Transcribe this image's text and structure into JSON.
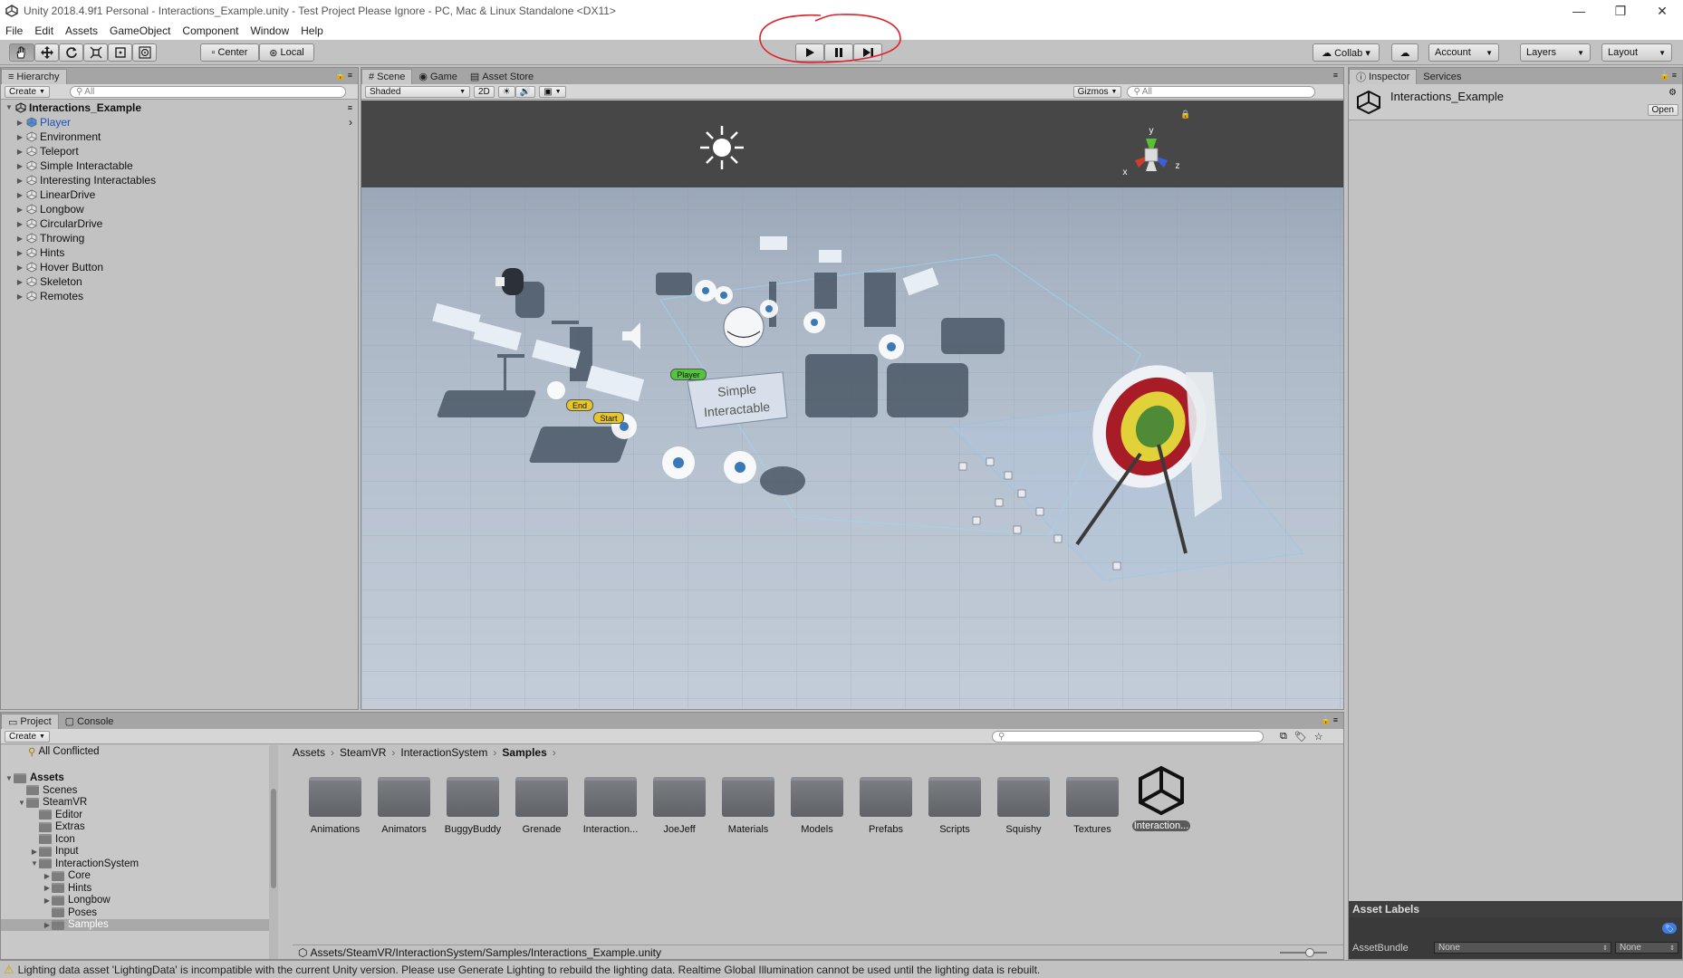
{
  "window": {
    "title": "Unity 2018.4.9f1 Personal - Interactions_Example.unity - Test Project Please Ignore - PC, Mac & Linux Standalone <DX11>",
    "minimize": "—",
    "maximize": "❐",
    "close": "✕"
  },
  "menu": [
    "File",
    "Edit",
    "Assets",
    "GameObject",
    "Component",
    "Window",
    "Help"
  ],
  "toolbar": {
    "pivot": "Center",
    "space": "Local",
    "collab": "Collab ▾",
    "account": "Account",
    "layers": "Layers",
    "layout": "Layout"
  },
  "hierarchy": {
    "tab": "Hierarchy",
    "create": "Create",
    "search_placeholder": "All",
    "scene": "Interactions_Example",
    "items": [
      "Player",
      "Environment",
      "Teleport",
      "Simple Interactable",
      "Interesting Interactables",
      "LinearDrive",
      "Longbow",
      "CircularDrive",
      "Throwing",
      "Hints",
      "Hover Button",
      "Skeleton",
      "Remotes"
    ]
  },
  "scene_view": {
    "tabs": [
      "Scene",
      "Game",
      "Asset Store"
    ],
    "shading": "Shaded",
    "mode_2d": "2D",
    "gizmos": "Gizmos",
    "search_placeholder": "All",
    "labels": {
      "player": "Player",
      "end": "End",
      "start": "Start",
      "sign": "Simple Interactable"
    },
    "axes": {
      "x": "x",
      "y": "y",
      "z": "z"
    }
  },
  "inspector": {
    "tabs": [
      "Inspector",
      "Services"
    ],
    "object": "Interactions_Example",
    "open": "Open",
    "asset_labels": "Asset Labels",
    "asset_bundle": "AssetBundle",
    "bundle_value": "None",
    "variant_value": "None"
  },
  "project": {
    "tabs": [
      "Project",
      "Console"
    ],
    "create": "Create",
    "all_conflicted": "All Conflicted",
    "tree": [
      {
        "label": "Assets",
        "depth": 0,
        "open": true,
        "bold": true
      },
      {
        "label": "Scenes",
        "depth": 1
      },
      {
        "label": "SteamVR",
        "depth": 1,
        "open": true
      },
      {
        "label": "Editor",
        "depth": 2
      },
      {
        "label": "Extras",
        "depth": 2
      },
      {
        "label": "Icon",
        "depth": 2
      },
      {
        "label": "Input",
        "depth": 2,
        "closed": true
      },
      {
        "label": "InteractionSystem",
        "depth": 2,
        "open": true
      },
      {
        "label": "Core",
        "depth": 3,
        "closed": true
      },
      {
        "label": "Hints",
        "depth": 3,
        "closed": true
      },
      {
        "label": "Longbow",
        "depth": 3,
        "closed": true
      },
      {
        "label": "Poses",
        "depth": 3
      },
      {
        "label": "Samples",
        "depth": 3,
        "closed": true,
        "selected": true
      }
    ],
    "breadcrumb": [
      "Assets",
      "SteamVR",
      "InteractionSystem",
      "Samples"
    ],
    "assets": [
      "Animations",
      "Animators",
      "BuggyBuddy",
      "Grenade",
      "Interaction...",
      "JoeJeff",
      "Materials",
      "Models",
      "Prefabs",
      "Scripts",
      "Squishy",
      "Textures",
      "Interaction..."
    ],
    "path": "Assets/SteamVR/InteractionSystem/Samples/Interactions_Example.unity"
  },
  "status": {
    "message": "Lighting data asset 'LightingData' is incompatible with the current Unity version. Please use Generate Lighting to rebuild the lighting data.  Realtime Global Illumination cannot be used until the lighting data is rebuilt."
  },
  "colors": {
    "annotation_red": "#e0202a",
    "selection_blue": "#3e7ce0"
  }
}
